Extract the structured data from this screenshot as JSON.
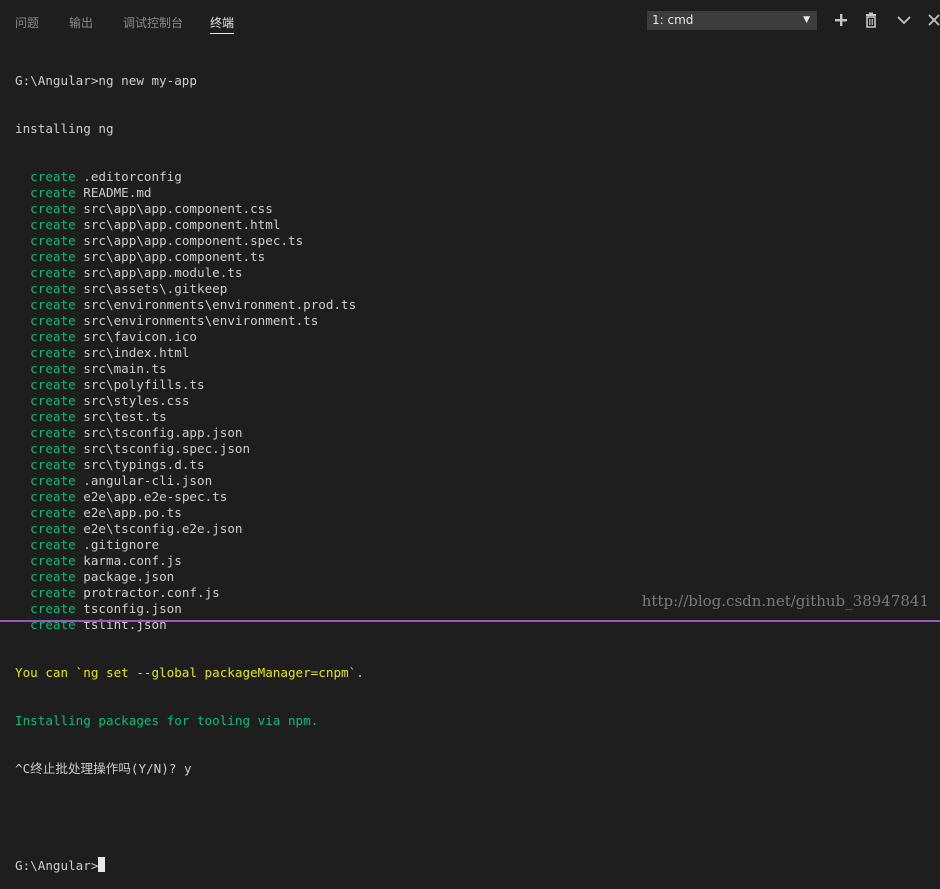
{
  "tabs": [
    {
      "label": "问题"
    },
    {
      "label": "输出"
    },
    {
      "label": "调试控制台"
    },
    {
      "label": "终端",
      "active": true
    }
  ],
  "terminal_select": {
    "value": "1: cmd"
  },
  "toolbar": {
    "icons": [
      "plus-icon",
      "trash-icon",
      "chevron-down-icon",
      "close-icon"
    ]
  },
  "terminal": {
    "prompt_line": "G:\\Angular>ng new my-app",
    "installing": "installing ng",
    "create_keyword": "create",
    "created_files": [
      ".editorconfig",
      "README.md",
      "src\\app\\app.component.css",
      "src\\app\\app.component.html",
      "src\\app\\app.component.spec.ts",
      "src\\app\\app.component.ts",
      "src\\app\\app.module.ts",
      "src\\assets\\.gitkeep",
      "src\\environments\\environment.prod.ts",
      "src\\environments\\environment.ts",
      "src\\favicon.ico",
      "src\\index.html",
      "src\\main.ts",
      "src\\polyfills.ts",
      "src\\styles.css",
      "src\\test.ts",
      "src\\tsconfig.app.json",
      "src\\tsconfig.spec.json",
      "src\\typings.d.ts",
      ".angular-cli.json",
      "e2e\\app.e2e-spec.ts",
      "e2e\\app.po.ts",
      "e2e\\tsconfig.e2e.json",
      ".gitignore",
      "karma.conf.js",
      "package.json",
      "protractor.conf.js",
      "tsconfig.json",
      "tslint.json"
    ],
    "hint_line": "You can `ng set --global packageManager=cnpm`.",
    "installing_packages": "Installing packages for tooling via npm.",
    "terminate_line": "^C终止批处理操作吗(Y/N)? y",
    "final_prompt": "G:\\Angular>"
  },
  "watermark": "http://blog.csdn.net/github_38947841",
  "colors": {
    "background": "#1e1e1e",
    "create_green": "#0dbc79",
    "hint_yellow": "#e5e510",
    "text": "#cccccc",
    "bottom_bar": "#9b59b6"
  }
}
